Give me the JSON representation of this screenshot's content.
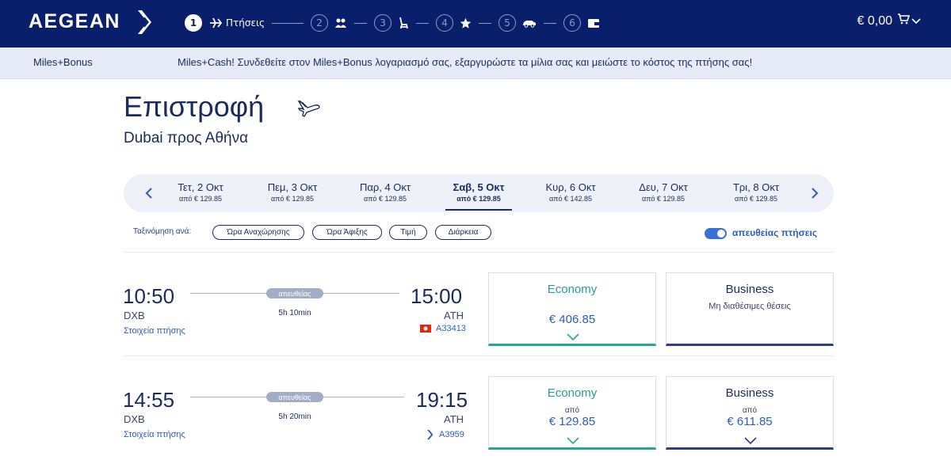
{
  "header": {
    "logo_text": "AEGEAN",
    "step_active": "1",
    "step_label": "Πτήσεις",
    "steps": [
      "2",
      "3",
      "4",
      "5",
      "6"
    ],
    "cart_total": "€ 0,00"
  },
  "promo": {
    "brand": "Miles+Bonus",
    "text": "Miles+Cash! Συνδεθείτε στον Miles+Bonus λογαριασμό σας, εξαργυρώστε τα μίλια σας και μειώστε το κόστος της πτήσης σας!"
  },
  "page": {
    "title": "Επιστροφή",
    "route": "Dubai προς Αθήνα"
  },
  "dates": [
    {
      "day": "Τετ, 2 Οκτ",
      "price": "από € 129.85"
    },
    {
      "day": "Πεμ, 3 Οκτ",
      "price": "από € 129.85"
    },
    {
      "day": "Παρ, 4 Οκτ",
      "price": "από € 129.85"
    },
    {
      "day": "Σαβ, 5 Οκτ",
      "price": "από € 129.85"
    },
    {
      "day": "Κυρ, 6 Οκτ",
      "price": "από € 142.85"
    },
    {
      "day": "Δευ, 7 Οκτ",
      "price": "από € 129.85"
    },
    {
      "day": "Τρι, 8 Οκτ",
      "price": "από € 129.85"
    }
  ],
  "sort": {
    "label": "Ταξινόμηση ανά:",
    "options": [
      "Ώρα Αναχώρησης",
      "Ώρα Άφιξης",
      "Τιμή",
      "Διάρκεια"
    ],
    "direct_label": "απευθείας πτήσεις"
  },
  "flights": [
    {
      "dep_time": "10:50",
      "dep_airport": "DXB",
      "details": "Στοιχεία πτήσης",
      "badge": "απευθείας",
      "duration": "5h 10min",
      "arr_time": "15:00",
      "arr_airport": "ATH",
      "flight_no": "A33413",
      "economy": {
        "label": "Economy",
        "price": "€ 406.85"
      },
      "business": {
        "label": "Business",
        "note": "Μη διαθέσιμες θέσεις"
      }
    },
    {
      "dep_time": "14:55",
      "dep_airport": "DXB",
      "details": "Στοιχεία πτήσης",
      "badge": "απευθείας",
      "duration": "5h 20min",
      "arr_time": "19:15",
      "arr_airport": "ATH",
      "flight_no": "A3959",
      "economy": {
        "label": "Economy",
        "from": "από",
        "price": "€ 129.85"
      },
      "business": {
        "label": "Business",
        "from": "από",
        "price": "€ 611.85"
      }
    }
  ]
}
